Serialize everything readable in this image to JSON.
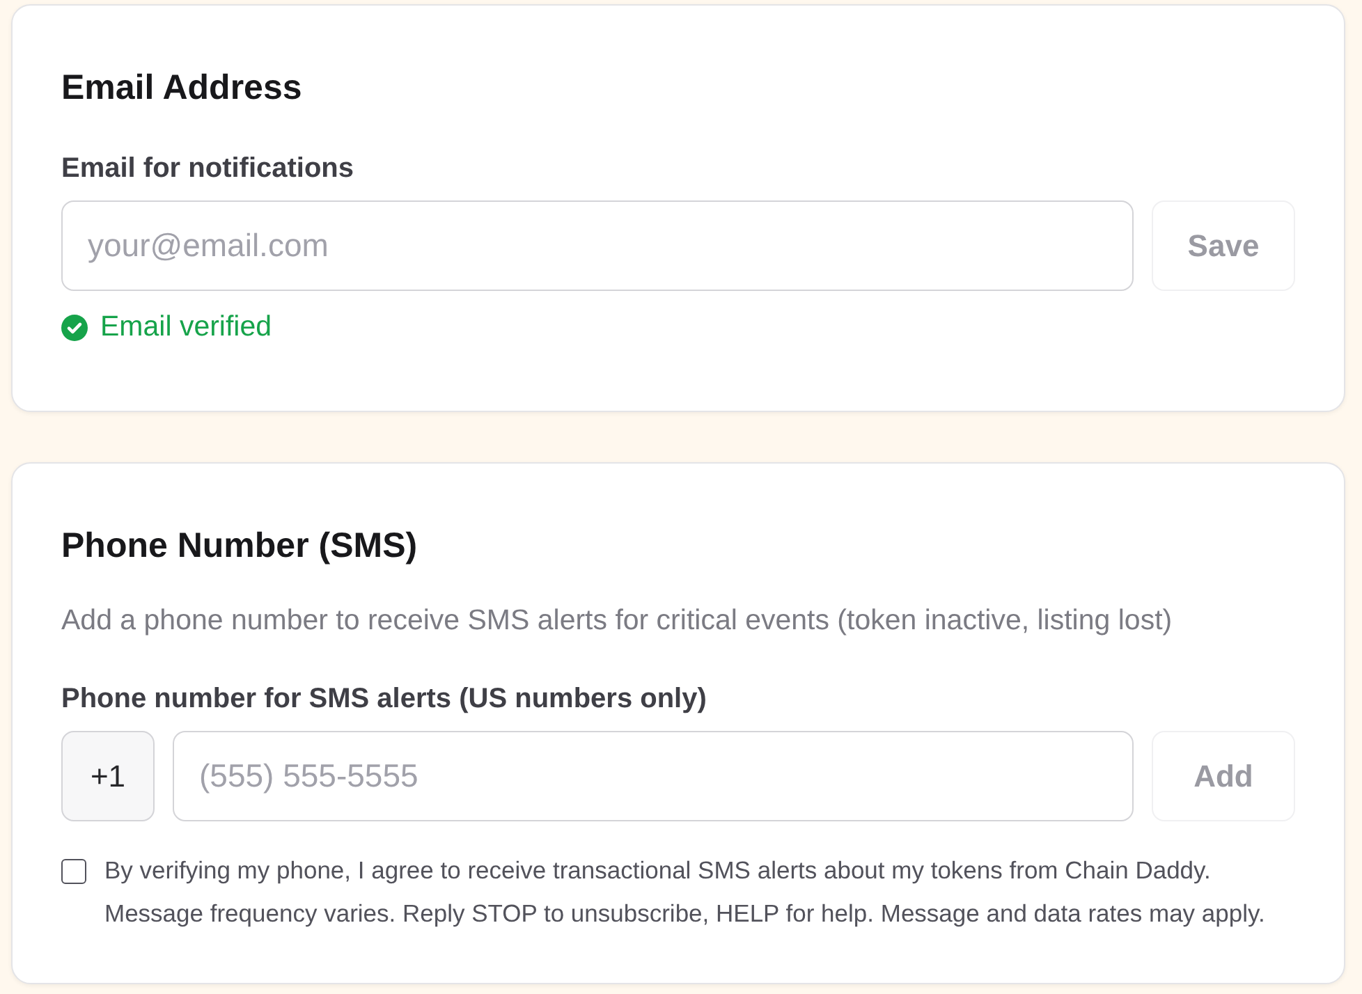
{
  "email_section": {
    "title": "Email Address",
    "field": {
      "label": "Email for notifications",
      "placeholder": "your@email.com"
    },
    "save_button": {
      "label": "Save",
      "disabled": true
    },
    "status": {
      "text": "Email verified",
      "verified": true
    }
  },
  "phone_section": {
    "title": "Phone Number (SMS)",
    "description": "Add a phone number to receive SMS alerts for critical events (token inactive, listing lost)",
    "field": {
      "label": "Phone number for SMS alerts (US numbers only)",
      "prefix": "+1",
      "placeholder": "(555) 555-5555"
    },
    "add_button": {
      "label": "Add",
      "disabled": true
    },
    "consent": {
      "checked": false,
      "text": "By verifying my phone, I agree to receive transactional SMS alerts about my tokens from Chain Daddy. Message frequency varies. Reply STOP to unsubscribe, HELP for help. Message and data rates may apply."
    }
  }
}
